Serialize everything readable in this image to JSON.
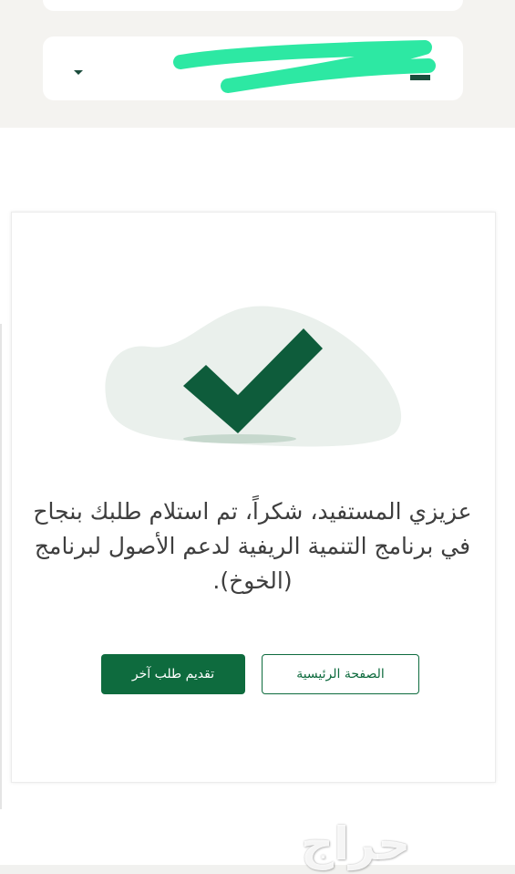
{
  "header": {
    "select_value": ""
  },
  "illustration": {
    "icon": "check-mark-icon",
    "check_color": "#0e5c3b",
    "blob_color": "#eaf0ec"
  },
  "message": {
    "text": "عزيزي المستفيد، شكراً، تم استلام طلبك بنجاح في برنامج التنمية الريفية لدعم الأصول لبرنامج (الخوخ)."
  },
  "actions": {
    "new_request_label": "تقديم طلب آخر",
    "home_label": "الصفحة الرئيسية"
  },
  "colors": {
    "primary": "#0e6b3e",
    "redaction": "#2de8a3"
  },
  "watermark": {
    "text": "حراج"
  }
}
